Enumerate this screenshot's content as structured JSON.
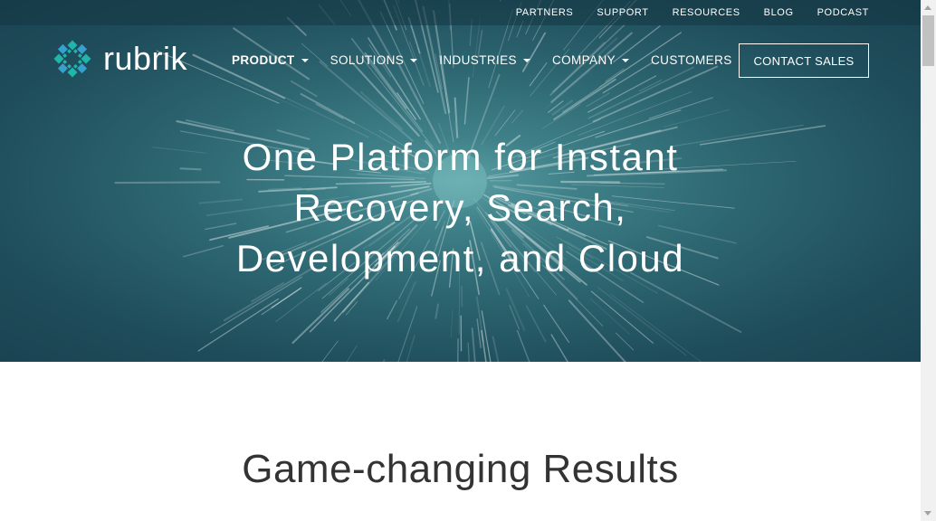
{
  "colors": {
    "hero_dark": "#1a4352",
    "hero_mid": "#2c6570",
    "hero_glow": "#5a9ea3",
    "logo_primary": "#1fb5ac",
    "logo_secondary": "#36a0cf",
    "text_light": "#ffffff",
    "text_dark": "#333333"
  },
  "utility_nav": [
    "PARTNERS",
    "SUPPORT",
    "RESOURCES",
    "BLOG",
    "PODCAST"
  ],
  "logo": {
    "text": "rubrik",
    "icon": "rubrik-logo-icon"
  },
  "main_nav": [
    {
      "label": "PRODUCT",
      "dropdown": true,
      "active": true
    },
    {
      "label": "SOLUTIONS",
      "dropdown": true,
      "active": false
    },
    {
      "label": "INDUSTRIES",
      "dropdown": true,
      "active": false
    },
    {
      "label": "COMPANY",
      "dropdown": true,
      "active": false
    },
    {
      "label": "CUSTOMERS",
      "dropdown": false,
      "active": false
    }
  ],
  "contact_button": "CONTACT SALES",
  "hero": {
    "headline_lines": [
      "One Platform for Instant",
      "Recovery, Search,",
      "Development, and Cloud"
    ]
  },
  "section": {
    "title": "Game-changing Results"
  }
}
